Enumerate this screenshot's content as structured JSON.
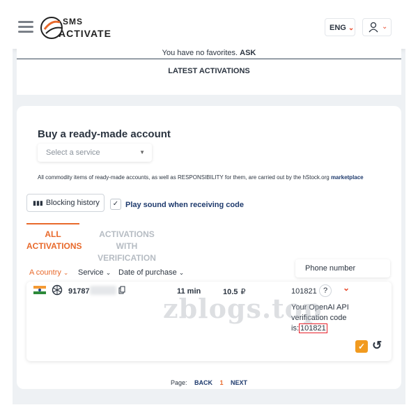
{
  "header": {
    "brand_line1": "SMS",
    "brand_line2": "ACTIVATE",
    "lang": "ENG",
    "lang_chevron": "⌄"
  },
  "favorites": {
    "text": "You have no favorites.",
    "link": "ASK"
  },
  "section_title": "LATEST ACTIVATIONS",
  "buy": {
    "title": "Buy a ready-made account",
    "select_placeholder": "Select a service",
    "notice": "All commodity items of ready-made accounts, as well as RESPONSIBILITY for them, are carried out by the hStock.org",
    "notice_link": "marketplace"
  },
  "controls": {
    "blocking_history": "Blocking history",
    "play_sound": "Play sound when receiving code"
  },
  "tabs": [
    {
      "line1": "ALL",
      "line2": "ACTIVATIONS",
      "active": true
    },
    {
      "line1": "ACTIVATIONS",
      "line2": "WITH VERIFICATION",
      "active": false
    }
  ],
  "filters": {
    "country": "A country",
    "service": "Service",
    "date": "Date of purchase",
    "phone_placeholder": "Phone number"
  },
  "activation": {
    "phone_prefix": "91787",
    "time": "11 min",
    "price": "10.5",
    "currency": "₽",
    "code": "101821",
    "help": "?",
    "sms_text": "Your OpenAI API verification code is:",
    "sms_code": "101821",
    "service_icon": "openai-icon",
    "country_icon": "india-flag-icon"
  },
  "pagination": {
    "label": "Page:",
    "back": "BACK",
    "current": "1",
    "next": "NEXT"
  },
  "watermark": "zblogs.top",
  "colors": {
    "accent": "#e8692b",
    "link": "#1e3a6d",
    "ok": "#f19a1f",
    "highlight": "#e8202a"
  }
}
